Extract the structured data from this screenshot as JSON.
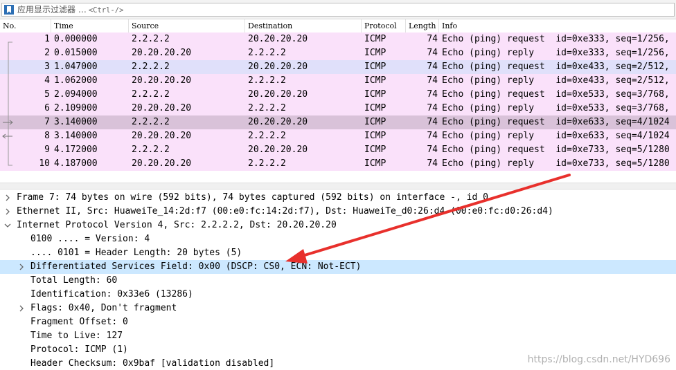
{
  "filter": {
    "label": "应用显示过滤器 …",
    "shortcut": "<Ctrl-/>"
  },
  "packet_list": {
    "columns": [
      "No.",
      "Time",
      "Source",
      "Destination",
      "Protocol",
      "Length",
      "Info"
    ],
    "rows": [
      {
        "no": "1",
        "time": "0.000000",
        "src": "2.2.2.2",
        "dst": "20.20.20.20",
        "proto": "ICMP",
        "len": "74",
        "info": "Echo (ping) request  id=0xe333, seq=1/256,"
      },
      {
        "no": "2",
        "time": "0.015000",
        "src": "20.20.20.20",
        "dst": "2.2.2.2",
        "proto": "ICMP",
        "len": "74",
        "info": "Echo (ping) reply    id=0xe333, seq=1/256,"
      },
      {
        "no": "3",
        "time": "1.047000",
        "src": "2.2.2.2",
        "dst": "20.20.20.20",
        "proto": "ICMP",
        "len": "74",
        "info": "Echo (ping) request  id=0xe433, seq=2/512,"
      },
      {
        "no": "4",
        "time": "1.062000",
        "src": "20.20.20.20",
        "dst": "2.2.2.2",
        "proto": "ICMP",
        "len": "74",
        "info": "Echo (ping) reply    id=0xe433, seq=2/512,"
      },
      {
        "no": "5",
        "time": "2.094000",
        "src": "2.2.2.2",
        "dst": "20.20.20.20",
        "proto": "ICMP",
        "len": "74",
        "info": "Echo (ping) request  id=0xe533, seq=3/768,"
      },
      {
        "no": "6",
        "time": "2.109000",
        "src": "20.20.20.20",
        "dst": "2.2.2.2",
        "proto": "ICMP",
        "len": "74",
        "info": "Echo (ping) reply    id=0xe533, seq=3/768,"
      },
      {
        "no": "7",
        "time": "3.140000",
        "src": "2.2.2.2",
        "dst": "20.20.20.20",
        "proto": "ICMP",
        "len": "74",
        "info": "Echo (ping) request  id=0xe633, seq=4/1024"
      },
      {
        "no": "8",
        "time": "3.140000",
        "src": "20.20.20.20",
        "dst": "2.2.2.2",
        "proto": "ICMP",
        "len": "74",
        "info": "Echo (ping) reply    id=0xe633, seq=4/1024"
      },
      {
        "no": "9",
        "time": "4.172000",
        "src": "2.2.2.2",
        "dst": "20.20.20.20",
        "proto": "ICMP",
        "len": "74",
        "info": "Echo (ping) request  id=0xe733, seq=5/1280"
      },
      {
        "no": "10",
        "time": "4.187000",
        "src": "20.20.20.20",
        "dst": "2.2.2.2",
        "proto": "ICMP",
        "len": "74",
        "info": "Echo (ping) reply    id=0xe733, seq=5/1280"
      }
    ]
  },
  "details": {
    "items": [
      {
        "text": "Frame 7: 74 bytes on wire (592 bits), 74 bytes captured (592 bits) on interface -, id 0",
        "expander": "collapsed"
      },
      {
        "text": "Ethernet II, Src: HuaweiTe_14:2d:f7 (00:e0:fc:14:2d:f7), Dst: HuaweiTe_d0:26:d4 (00:e0:fc:d0:26:d4)",
        "expander": "collapsed"
      },
      {
        "text": "Internet Protocol Version 4, Src: 2.2.2.2, Dst: 20.20.20.20",
        "expander": "expanded"
      },
      {
        "text": "0100 .... = Version: 4",
        "expander": "none"
      },
      {
        "text": ".... 0101 = Header Length: 20 bytes (5)",
        "expander": "none"
      },
      {
        "text": "Differentiated Services Field: 0x00 (DSCP: CS0, ECN: Not-ECT)",
        "expander": "collapsed"
      },
      {
        "text": "Total Length: 60",
        "expander": "none"
      },
      {
        "text": "Identification: 0x33e6 (13286)",
        "expander": "none"
      },
      {
        "text": "Flags: 0x40, Don't fragment",
        "expander": "collapsed"
      },
      {
        "text": "Fragment Offset: 0",
        "expander": "none"
      },
      {
        "text": "Time to Live: 127",
        "expander": "none"
      },
      {
        "text": "Protocol: ICMP (1)",
        "expander": "none"
      },
      {
        "text": "Header Checksum: 0x9baf [validation disabled]",
        "expander": "none"
      }
    ]
  },
  "colors": {
    "row_bg": "#fae1fa",
    "row_selected": "#e0e0fa",
    "row_current": "#d9c2d9",
    "detail_highlight": "#cce8ff",
    "annotation_arrow": "#e8302c"
  },
  "watermark": "https://blog.csdn.net/HYD696"
}
